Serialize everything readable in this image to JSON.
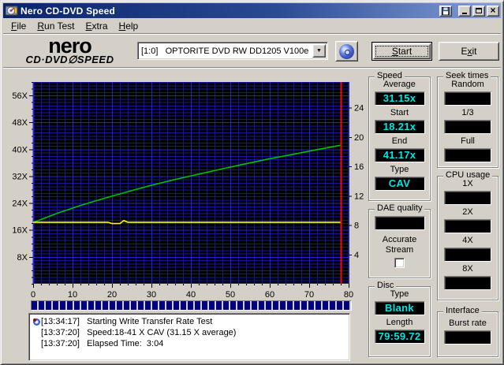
{
  "window": {
    "title": "Nero CD-DVD Speed",
    "buttons": {
      "save": "save-window-button",
      "minimize": "minimize",
      "maximize": "maximize",
      "close": "close"
    }
  },
  "menu": {
    "items": [
      {
        "label": "File",
        "ul": 0
      },
      {
        "label": "Run Test",
        "ul": 0
      },
      {
        "label": "Extra",
        "ul": 0
      },
      {
        "label": "Help",
        "ul": 0
      }
    ]
  },
  "toolbar": {
    "logo_top": "nero",
    "logo_bottom": "CD·DVD∅SPEED",
    "drive_selected": "[1:0]   OPTORITE DVD RW DD1205 V100e",
    "start": {
      "label": "Start",
      "ul": 0
    },
    "exit": {
      "label": "Exit",
      "ul": 1
    }
  },
  "chart_data": {
    "type": "line",
    "title": "CD write transfer rate test",
    "x_range": [
      0,
      80
    ],
    "x_ticks": [
      0,
      10,
      20,
      30,
      40,
      50,
      60,
      70,
      80
    ],
    "x_minor_step": 2,
    "y_left_range": [
      0,
      60
    ],
    "y_left_ticks": [
      8,
      16,
      24,
      32,
      40,
      48,
      56
    ],
    "y_left_suffix": "X",
    "y_left_minor_step": 1,
    "y_right_range": [
      0,
      27.5
    ],
    "y_right_ticks": [
      4,
      8,
      12,
      16,
      20,
      24
    ],
    "grid": true,
    "colors": {
      "plot_bg": "#000000",
      "grid_minor": "#16169c",
      "grid_major": "#2222dd",
      "speed_line": "#00c000",
      "rotation_line": "#ffff00",
      "marker_line": "#ff0000"
    },
    "series": [
      {
        "name": "write-speed-x",
        "color_key": "speed_line",
        "points": [
          [
            0,
            18.2
          ],
          [
            6,
            20.9
          ],
          [
            12,
            23.3
          ],
          [
            18,
            25.4
          ],
          [
            24,
            27.4
          ],
          [
            30,
            29.3
          ],
          [
            36,
            31.0
          ],
          [
            42,
            32.6
          ],
          [
            48,
            34.2
          ],
          [
            54,
            35.7
          ],
          [
            60,
            37.2
          ],
          [
            66,
            38.5
          ],
          [
            72,
            39.9
          ],
          [
            78,
            41.2
          ]
        ]
      },
      {
        "name": "rotation-speed",
        "color_key": "rotation_line",
        "points": [
          [
            0,
            18.3
          ],
          [
            19,
            18.3
          ],
          [
            20,
            17.9
          ],
          [
            22,
            17.9
          ],
          [
            23,
            18.8
          ],
          [
            24,
            18.3
          ],
          [
            78,
            18.3
          ]
        ]
      }
    ],
    "marker_x": 78
  },
  "progress": {
    "percent": 100
  },
  "panels": {
    "speed": {
      "title": "Speed",
      "fields": [
        {
          "label": "Average",
          "value": "31.15x"
        },
        {
          "label": "Start",
          "value": "18.21x"
        },
        {
          "label": "End",
          "value": "41.17x"
        },
        {
          "label": "Type",
          "value": "CAV"
        }
      ]
    },
    "seek_times": {
      "title": "Seek times",
      "fields": [
        {
          "label": "Random",
          "value": ""
        },
        {
          "label": "1/3",
          "value": ""
        },
        {
          "label": "Full",
          "value": ""
        }
      ]
    },
    "cpu_usage": {
      "title": "CPU usage",
      "fields": [
        {
          "label": "1X",
          "value": ""
        },
        {
          "label": "2X",
          "value": ""
        },
        {
          "label": "4X",
          "value": ""
        },
        {
          "label": "8X",
          "value": ""
        }
      ]
    },
    "dae_quality": {
      "title": "DAE quality",
      "value": "",
      "accurate_stream_line1": "Accurate",
      "accurate_stream_line2": "Stream",
      "checkbox_checked": false
    },
    "disc": {
      "title": "Disc",
      "fields": [
        {
          "label": "Type",
          "value": "Blank"
        },
        {
          "label": "Length",
          "value": "79:59.72"
        }
      ]
    },
    "interface": {
      "title": "Interface",
      "fields": [
        {
          "label": "Burst rate",
          "value": ""
        }
      ]
    }
  },
  "log": {
    "entries": [
      {
        "time": "[13:34:17]",
        "text": "Starting Write Transfer Rate Test",
        "icon": true
      },
      {
        "time": "[13:37:20]",
        "text": "Speed:18-41 X CAV (31.15 X average)",
        "icon": false
      },
      {
        "time": "[13:37:20]",
        "text": "Elapsed Time:  3:04",
        "icon": false
      }
    ]
  }
}
